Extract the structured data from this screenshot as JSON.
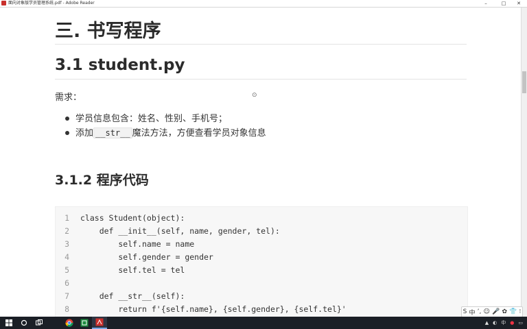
{
  "window": {
    "title": "面向对象版学员管理系统.pdf - Adobe Reader",
    "min_icon": "–",
    "max_icon": "□",
    "close_icon": "✕"
  },
  "document": {
    "h1": "三. 书写程序",
    "h2": "3.1 student.py",
    "requirement_label": "需求：",
    "bullets": [
      {
        "text": "学员信息包含：姓名、性别、手机号；"
      },
      {
        "prefix": "添加",
        "code": "__str__",
        "suffix": "魔法方法，方便查看学员对象信息"
      }
    ],
    "h3": "3.1.2 程序代码",
    "code_lines": [
      {
        "num": "1",
        "code": "class Student(object):"
      },
      {
        "num": "2",
        "code": "    def __init__(self, name, gender, tel):"
      },
      {
        "num": "3",
        "code": "        self.name = name"
      },
      {
        "num": "4",
        "code": "        self.gender = gender"
      },
      {
        "num": "5",
        "code": "        self.tel = tel"
      },
      {
        "num": "6",
        "code": ""
      },
      {
        "num": "7",
        "code": "    def __str__(self):"
      },
      {
        "num": "8",
        "code": "        return f'{self.name}, {self.gender}, {self.tel}'"
      }
    ]
  },
  "ime": {
    "items": [
      "S",
      "中",
      "ʼ,",
      "☺",
      "🎤",
      "✿",
      "👕",
      "⁝"
    ]
  },
  "colors": {
    "accent_red": "#c9302c",
    "taskbar": "#1b1f26",
    "keyword": "#7a27a8",
    "string": "#b31d28"
  }
}
